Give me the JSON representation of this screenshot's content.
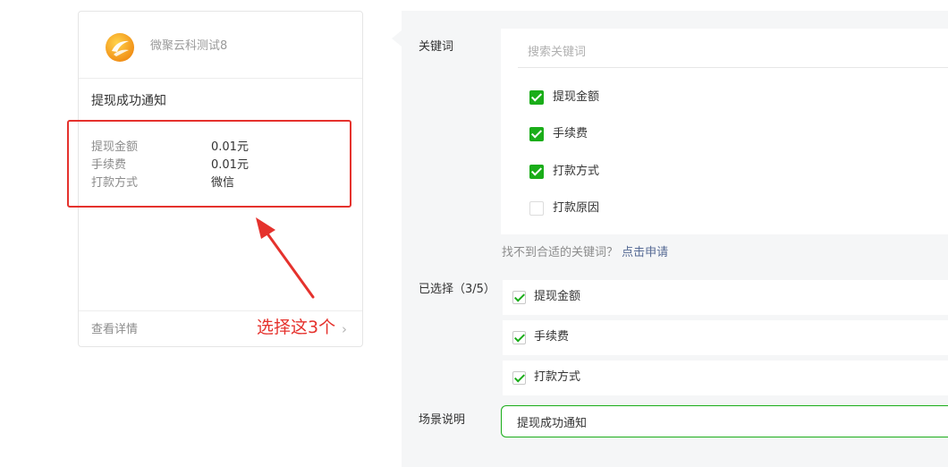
{
  "preview": {
    "brand_name": "微聚云科测试8",
    "template_title": "提现成功通知",
    "fields": [
      {
        "key": "提现金额",
        "value": "0.01元"
      },
      {
        "key": "手续费",
        "value": "0.01元"
      },
      {
        "key": "打款方式",
        "value": "微信"
      }
    ],
    "footer_link": "查看详情",
    "chevron": "›"
  },
  "annotation": {
    "text": "选择这3个",
    "color": "#e5322d"
  },
  "settings": {
    "keyword_label": "关键词",
    "search_placeholder": "搜索关键词",
    "options": [
      {
        "label": "提现金额",
        "checked": true
      },
      {
        "label": "手续费",
        "checked": true
      },
      {
        "label": "打款方式",
        "checked": true
      },
      {
        "label": "打款原因",
        "checked": false
      }
    ],
    "hint_text": "找不到合适的关键词？",
    "hint_link": "点击申请",
    "selected_label": "已选择（3/5）",
    "selected": [
      "提现金额",
      "手续费",
      "打款方式"
    ],
    "scene_label": "场景说明",
    "scene_value": "提现成功通知"
  },
  "colors": {
    "accent_green": "#1aad19",
    "link_blue": "#576b95",
    "panel_bg": "#f5f6f7"
  }
}
